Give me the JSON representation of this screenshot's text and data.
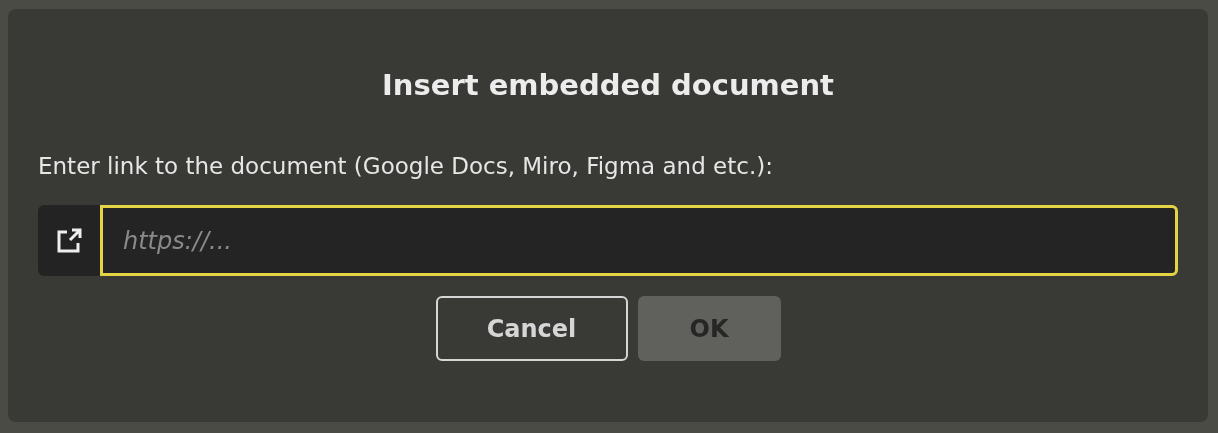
{
  "dialog": {
    "title": "Insert embedded document",
    "label": "Enter link to the document (Google Docs, Miro, Figma and etc.):",
    "input": {
      "placeholder": "https://...",
      "focused": true
    },
    "buttons": [
      {
        "label": "Cancel",
        "kind": "secondary",
        "disabled": false
      },
      {
        "label": "OK",
        "kind": "primary",
        "disabled": true
      }
    ]
  }
}
